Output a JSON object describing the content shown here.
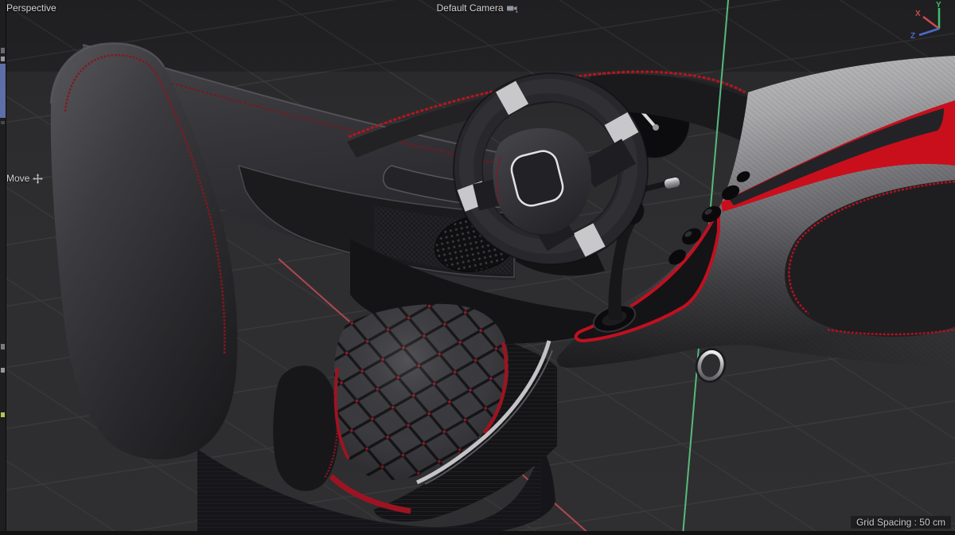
{
  "hud": {
    "view_label": "Perspective",
    "camera_label": "Default Camera",
    "tool_label": "Move",
    "grid_spacing_label": "Grid Spacing : 50 cm",
    "axis_gizmo": {
      "x_label": "X",
      "y_label": "Y",
      "z_label": "Z"
    }
  },
  "colors": {
    "viewport_bg": "#2d2d2f",
    "accent_red": "#c8101e",
    "stitch_red": "#9c1421",
    "world_axis_y_green": "#57b97c",
    "world_axis_x_red": "#b0474f",
    "gizmo_x": "#cf4b4b",
    "gizmo_y": "#3fc06a",
    "gizmo_z": "#4a6ace",
    "selection_blue": "#5e6fa6",
    "silver_trim": "#c6c6c9"
  }
}
